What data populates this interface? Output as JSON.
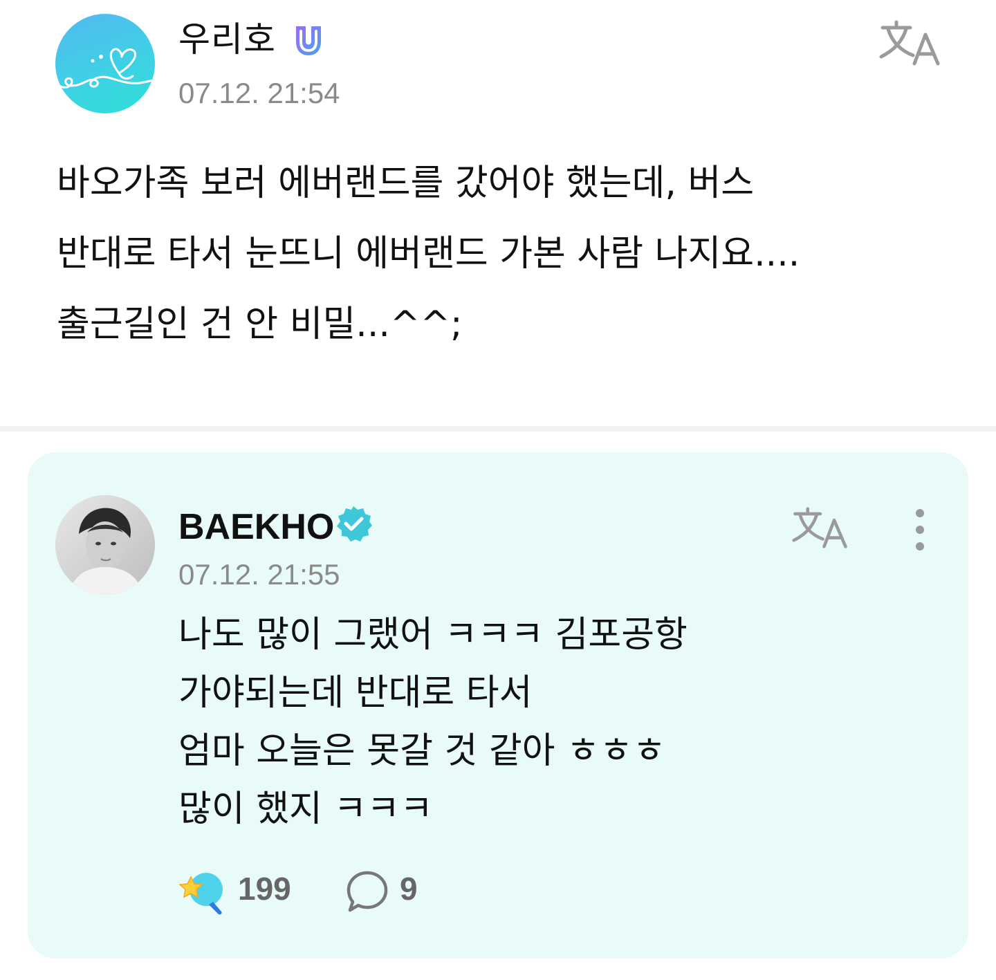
{
  "post": {
    "author": "우리호",
    "timestamp": "07.12. 21:54",
    "body_lines": [
      "바오가족 보러 에버랜드를 갔어야 했는데, 버스",
      "반대로 타서 눈뜨니 에버랜드 가본 사람 나지요....",
      "출근길인 건 안 비밀...^^;"
    ],
    "badge_icon": "membership-badge-icon",
    "translate_icon": "translate-icon"
  },
  "reply": {
    "author": "BAEKHO",
    "timestamp": "07.12. 21:55",
    "body_lines": [
      "나도 많이 그랬어 ㅋㅋㅋ 김포공항",
      "가야되는데 반대로 타서",
      "엄마 오늘은 못갈 것 같아 ㅎㅎㅎ",
      "많이 했지 ㅋㅋㅋ"
    ],
    "like_count": "199",
    "comment_count": "9",
    "verified_icon": "verified-badge-icon",
    "translate_icon": "translate-icon",
    "more_icon": "more-vertical-icon"
  },
  "colors": {
    "reply_background": "#e8fbf8",
    "verified_badge": "#3ec7d9",
    "timestamp": "#8a8a8a",
    "fan_avatar": "#3fd0e6"
  }
}
